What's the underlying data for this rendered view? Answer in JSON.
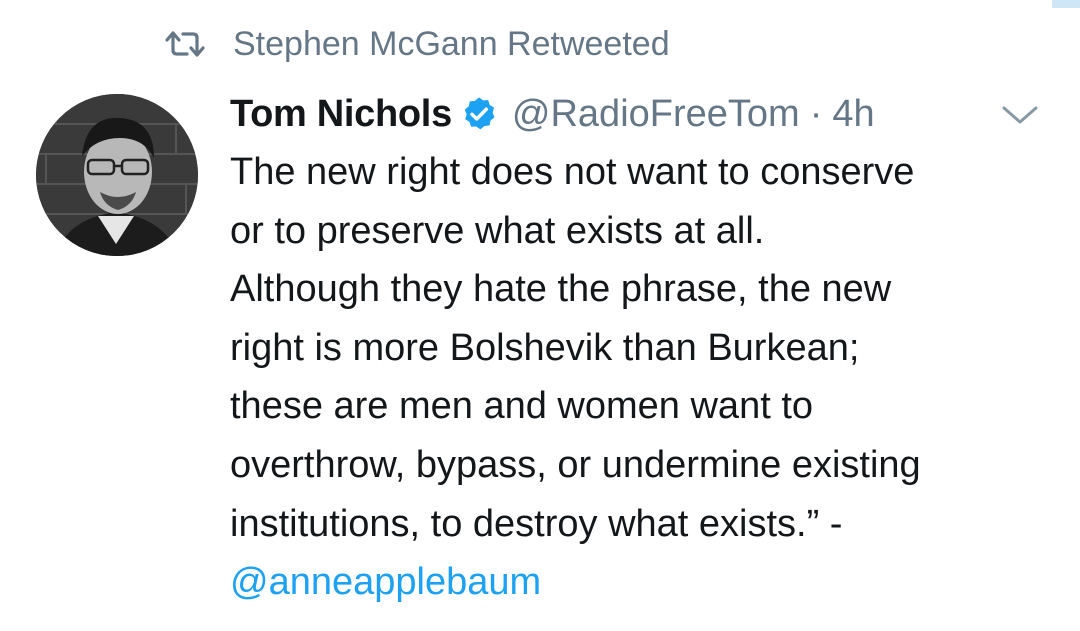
{
  "retweet": {
    "icon": "retweet-icon",
    "text": "Stephen McGann Retweeted"
  },
  "author": {
    "avatar_icon": "avatar-photo",
    "name": "Tom Nichols",
    "verified_icon": "verified-badge-icon",
    "handle": "@RadioFreeTom",
    "separator": "·",
    "time": "4h",
    "menu_icon": "chevron-down-icon"
  },
  "tweet": {
    "lines": [
      "The new right does not want to conserve",
      "or to preserve what exists at all.",
      "Although they hate the phrase, the new",
      "right is more Bolshevik than Burkean;",
      "these are men and women want to",
      "overthrow, bypass, or undermine existing",
      "institutions, to destroy what exists.” -"
    ],
    "mention": "@anneapplebaum"
  },
  "colors": {
    "text": "#14171a",
    "secondary": "#657786",
    "accent": "#1da1f2"
  }
}
